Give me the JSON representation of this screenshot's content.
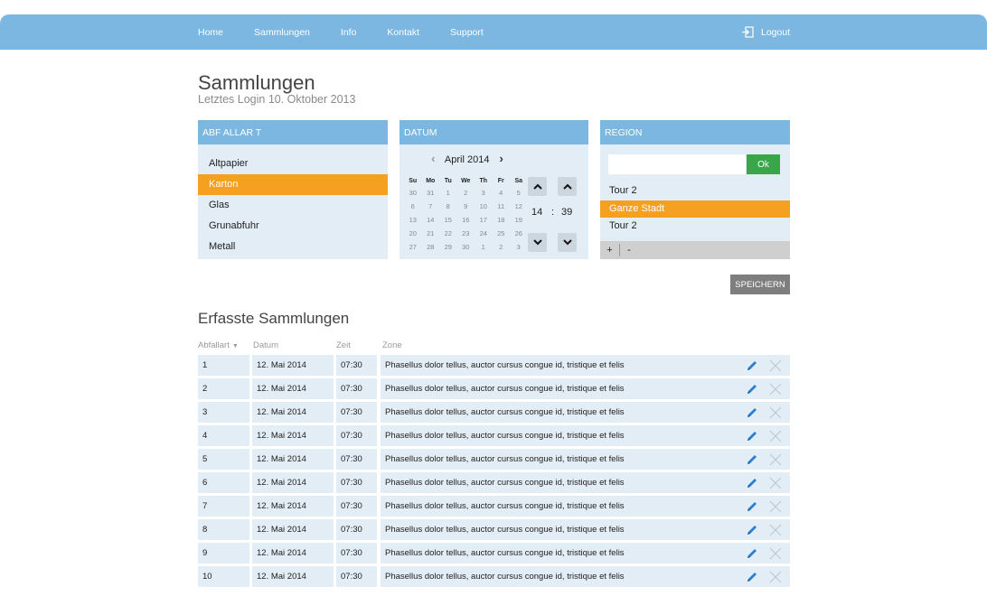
{
  "nav": {
    "items": [
      "Home",
      "Sammlungen",
      "Info",
      "Kontakt",
      "Support"
    ],
    "logout": "Logout",
    "logout_icon": "logout-icon"
  },
  "header": {
    "title": "Sammlungen",
    "subtitle": "Letztes Login 10. Oktober 2013"
  },
  "abfallart": {
    "title": "ABF ALLAR T",
    "items": [
      "Altpapier",
      "Karton",
      "Glas",
      "Grunabfuhr",
      "Metall"
    ],
    "selected_index": 1
  },
  "datum": {
    "title": "DATUM",
    "month": "April 2014",
    "weekdays": [
      "Su",
      "Mo",
      "Tu",
      "We",
      "Th",
      "Fr",
      "Sa"
    ],
    "weeks": [
      [
        "30",
        "31",
        "1",
        "2",
        "3",
        "4",
        "5"
      ],
      [
        "6",
        "7",
        "8",
        "9",
        "10",
        "11",
        "12"
      ],
      [
        "13",
        "14",
        "15",
        "16",
        "17",
        "18",
        "19"
      ],
      [
        "20",
        "21",
        "22",
        "23",
        "24",
        "25",
        "26"
      ],
      [
        "27",
        "28",
        "29",
        "30",
        "1",
        "2",
        "3"
      ]
    ],
    "hour": "14",
    "separator": ":",
    "minute": "39"
  },
  "region": {
    "title": "REGION",
    "input_value": "",
    "ok_label": "Ok",
    "items": [
      "Tour 2",
      "Ganze Stadt",
      "Tour 2"
    ],
    "selected_index": 1,
    "add_label": "+",
    "remove_label": "-"
  },
  "save_label": "SPEICHERN",
  "table": {
    "title": "Erfasste Sammlungen",
    "headers": [
      "Abfallart",
      "Datum",
      "Zeit",
      "Zone"
    ],
    "rows": [
      [
        "1",
        "12. Mai 2014",
        "07:30",
        "Phasellus dolor tellus, auctor cursus congue id, tristique et felis"
      ],
      [
        "2",
        "12. Mai 2014",
        "07:30",
        "Phasellus dolor tellus, auctor cursus congue id, tristique et felis"
      ],
      [
        "3",
        "12. Mai 2014",
        "07:30",
        "Phasellus dolor tellus, auctor cursus congue id, tristique et felis"
      ],
      [
        "4",
        "12. Mai 2014",
        "07:30",
        "Phasellus dolor tellus, auctor cursus congue id, tristique et felis"
      ],
      [
        "5",
        "12. Mai 2014",
        "07:30",
        "Phasellus dolor tellus, auctor cursus congue id, tristique et felis"
      ],
      [
        "6",
        "12. Mai 2014",
        "07:30",
        "Phasellus dolor tellus, auctor cursus congue id, tristique et felis"
      ],
      [
        "7",
        "12. Mai 2014",
        "07:30",
        "Phasellus dolor tellus, auctor cursus congue id, tristique et felis"
      ],
      [
        "8",
        "12. Mai 2014",
        "07:30",
        "Phasellus dolor tellus, auctor cursus congue id, tristique et felis"
      ],
      [
        "9",
        "12. Mai 2014",
        "07:30",
        "Phasellus dolor tellus, auctor cursus congue id, tristique et felis"
      ],
      [
        "10",
        "12. Mai 2014",
        "07:30",
        "Phasellus dolor tellus, auctor cursus congue id, tristique et felis"
      ]
    ]
  },
  "colors": {
    "primary": "#7bb7e0",
    "selected": "#f5a020",
    "panel_bg": "#e3edf6",
    "ok_green": "#3aa64a",
    "edit_blue": "#2a7fd0"
  }
}
